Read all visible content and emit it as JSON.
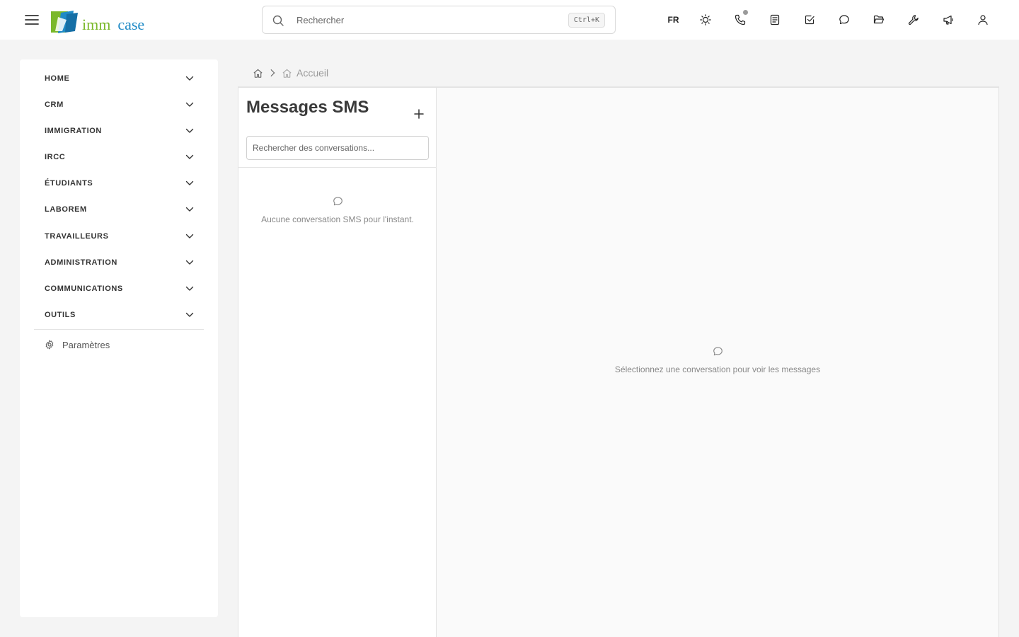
{
  "header": {
    "logo": {
      "word1": "imm",
      "word2": "case",
      "colors": {
        "green": "#7ab82a",
        "blue": "#1f8ac6"
      }
    },
    "search": {
      "placeholder": "Rechercher",
      "shortcut": "Ctrl+K"
    },
    "language": "FR",
    "icons": [
      "sun-icon",
      "phone-icon",
      "notes-icon",
      "task-check-icon",
      "chat-icon",
      "folder-open-icon",
      "wrench-icon",
      "megaphone-icon",
      "user-icon"
    ]
  },
  "sidebar": {
    "items": [
      {
        "label": "HOME"
      },
      {
        "label": "CRM"
      },
      {
        "label": "IMMIGRATION"
      },
      {
        "label": "IRCC"
      },
      {
        "label": "ÉTUDIANTS"
      },
      {
        "label": "LABOREM"
      },
      {
        "label": "TRAVAILLEURS"
      },
      {
        "label": "ADMINISTRATION"
      },
      {
        "label": "COMMUNICATIONS"
      },
      {
        "label": "OUTILS"
      }
    ],
    "settings_label": "Paramètres"
  },
  "breadcrumb": {
    "current": "Accueil"
  },
  "conversations": {
    "title": "Messages SMS",
    "search_placeholder": "Rechercher des conversations...",
    "empty_text": "Aucune conversation SMS pour l'instant."
  },
  "message_pane": {
    "empty_text": "Sélectionnez une conversation pour voir les messages"
  }
}
